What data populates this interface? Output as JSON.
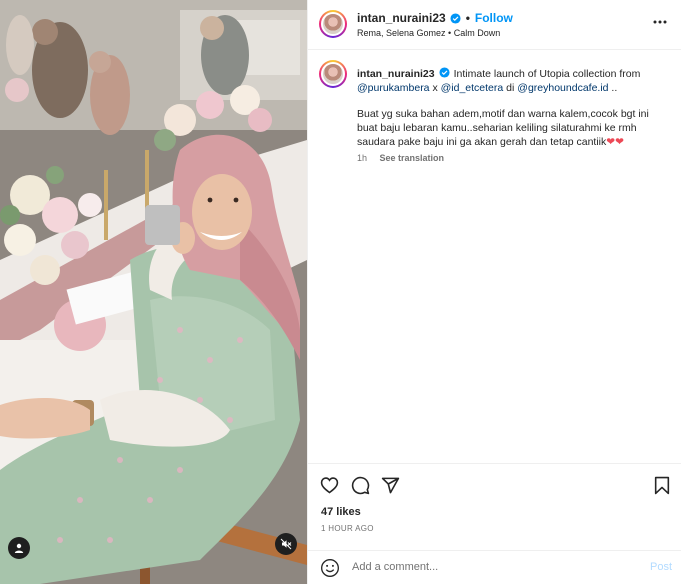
{
  "post": {
    "username": "intan_nuraini23",
    "follow_label": "Follow",
    "dot": "•",
    "audio": "Rema, Selena Gomez • Calm Down",
    "caption_intro": "Intimate launch of Utopia collection from",
    "mention_1": "@purukambera",
    "x_sep": "x",
    "mention_2": "@id_etcetera",
    "di": "di",
    "mention_3": "@greyhoundcafe.id",
    "trail": "..",
    "caption_body": "Buat yg suka bahan adem,motif dan warna kalem,cocok bgt ini buat baju lebaran kamu..seharian keliling silaturahmi ke rmh saudara pake baju ini ga akan gerah dan tetap cantiik",
    "hearts": "❤❤",
    "time": "1h",
    "see_translation": "See translation",
    "likes": "47 likes",
    "time_ago": "1 HOUR AGO",
    "comment_placeholder": "Add a comment...",
    "post_label": "Post"
  },
  "icons": {
    "more": "more-options-icon",
    "like": "heart-icon",
    "comment": "comment-icon",
    "share": "share-icon",
    "save": "bookmark-icon",
    "emoji": "emoji-icon",
    "user_tag": "user-tag-icon",
    "mute": "mute-icon",
    "verified": "verified-badge-icon"
  },
  "colors": {
    "link": "#0095f6",
    "mention": "#00376b",
    "heart": "#ed4956",
    "muted_text": "#737373",
    "post_disabled": "#b3dbff"
  }
}
